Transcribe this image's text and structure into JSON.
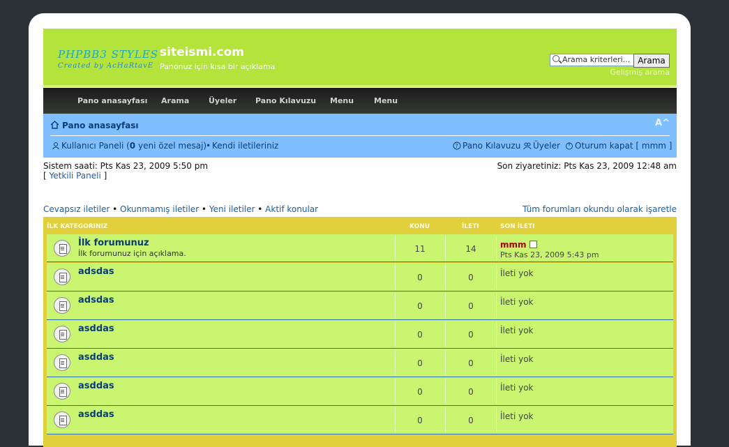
{
  "header": {
    "logo_line1": "PHPBB3 STYLES",
    "logo_line2": "Created by AcHaRtavE",
    "site_title": "siteismi.com",
    "site_description": "Panonuz için kısa bir açıklama",
    "search_placeholder": "Arama kriterleri...",
    "search_button": "Arama",
    "advanced_search": "Gelişmiş arama"
  },
  "navbar": {
    "items": [
      "Pano anasayfası",
      "Arama",
      "Üyeler",
      "Pano Kılavuzu",
      "Menu",
      "Menu"
    ]
  },
  "breadcrumb": {
    "home": "Pano anasayfası",
    "font_resize": "A^"
  },
  "user_links": {
    "user_panel": "Kullanıcı Paneli",
    "pm_count": "0",
    "pm_text": "yeni özel mesaj",
    "own_posts": "Kendi iletileriniz",
    "faq": "Pano Kılavuzu",
    "members": "Üyeler",
    "logout": "Oturum kapat [ mmm ]"
  },
  "info": {
    "system_time": "Sistem saati: Pts Kas 23, 2009 5:50 pm",
    "mod_panel": "Yetkili Paneli",
    "last_visit": "Son ziyaretiniz: Pts Kas 23, 2009 12:48 am"
  },
  "quick_links": {
    "unanswered": "Cevapsız iletiler",
    "unread": "Okunmamış iletiler",
    "new_posts": "Yeni iletiler",
    "active_topics": "Aktif konular",
    "mark_all_read": "Tüm forumları okundu olarak işaretle"
  },
  "forum_table": {
    "category": "İLK KATEGORINIZ",
    "col_topics": "KONU",
    "col_posts": "İLETI",
    "col_last_post": "SON İLETI",
    "rows": [
      {
        "name": "İlk forumunuz",
        "desc": "İlk forumunuz için açıklama.",
        "topics": "11",
        "posts": "14",
        "last_user": "mmm",
        "last_time": "Pts Kas 23, 2009 5:43 pm",
        "last": ""
      },
      {
        "name": "adsdas",
        "desc": "",
        "topics": "0",
        "posts": "0",
        "last_user": "",
        "last_time": "",
        "last": "İleti yok"
      },
      {
        "name": "adsdas",
        "desc": "",
        "topics": "0",
        "posts": "0",
        "last_user": "",
        "last_time": "",
        "last": "İleti yok"
      },
      {
        "name": "asddas",
        "desc": "",
        "topics": "0",
        "posts": "0",
        "last_user": "",
        "last_time": "",
        "last": "İleti yok"
      },
      {
        "name": "asddas",
        "desc": "",
        "topics": "0",
        "posts": "0",
        "last_user": "",
        "last_time": "",
        "last": "İleti yok"
      },
      {
        "name": "asddas",
        "desc": "",
        "topics": "0",
        "posts": "0",
        "last_user": "",
        "last_time": "",
        "last": "İleti yok"
      },
      {
        "name": "asddas",
        "desc": "",
        "topics": "0",
        "posts": "0",
        "last_user": "",
        "last_time": "",
        "last": "İleti yok"
      }
    ]
  },
  "colors": {
    "header_green": "#b4e43c",
    "blue_bar": "#7fbfff",
    "forum_box": "#e1cf3c",
    "row_green": "#c9f570"
  }
}
